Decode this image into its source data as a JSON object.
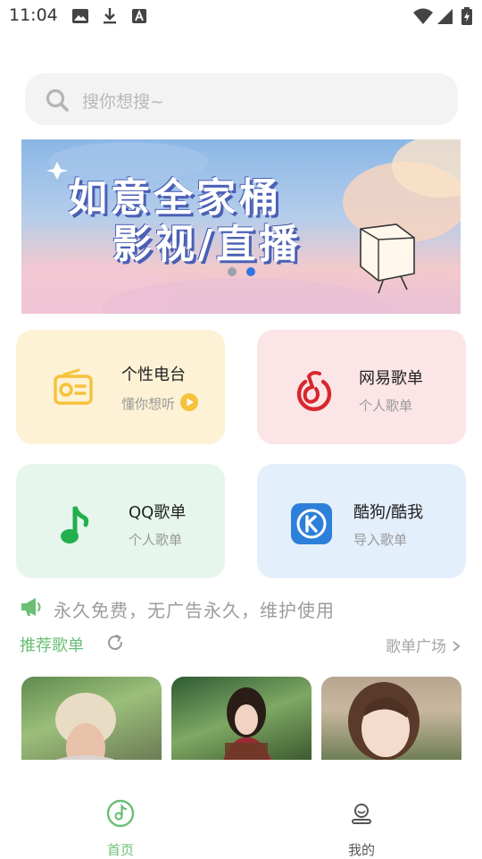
{
  "status_bar": {
    "time": "11:04"
  },
  "search": {
    "placeholder": "搜你想搜~"
  },
  "banner": {
    "line1": "如意全家桶",
    "line2": "影视/直播",
    "active_dot": 1
  },
  "cards": [
    {
      "title": "个性电台",
      "subtitle": "懂你想听",
      "icon": "radio-icon",
      "bg": "#fdf2d5",
      "accent": "#f6c23a"
    },
    {
      "title": "网易歌单",
      "subtitle": "个人歌单",
      "icon": "netease-music-icon",
      "bg": "#fce5e7",
      "accent": "#d7282f"
    },
    {
      "title": "QQ歌单",
      "subtitle": "个人歌单",
      "icon": "qq-music-icon",
      "bg": "#e6f6ec",
      "accent": "#22b04e"
    },
    {
      "title": "酷狗/酷我",
      "subtitle": "导入歌单",
      "icon": "kugou-icon",
      "bg": "#e4effc",
      "accent": "#2d80d9"
    }
  ],
  "notice": {
    "text": "永久免费，无广告永久，维护使用"
  },
  "recommend": {
    "title": "推荐歌单",
    "more_label": "歌单广场"
  },
  "tabs": [
    {
      "label": "首页",
      "icon": "music-disc-icon",
      "active": true
    },
    {
      "label": "我的",
      "icon": "profile-icon",
      "active": false
    }
  ],
  "colors": {
    "accent_green": "#6abf76",
    "tab_inactive": "#555555"
  }
}
